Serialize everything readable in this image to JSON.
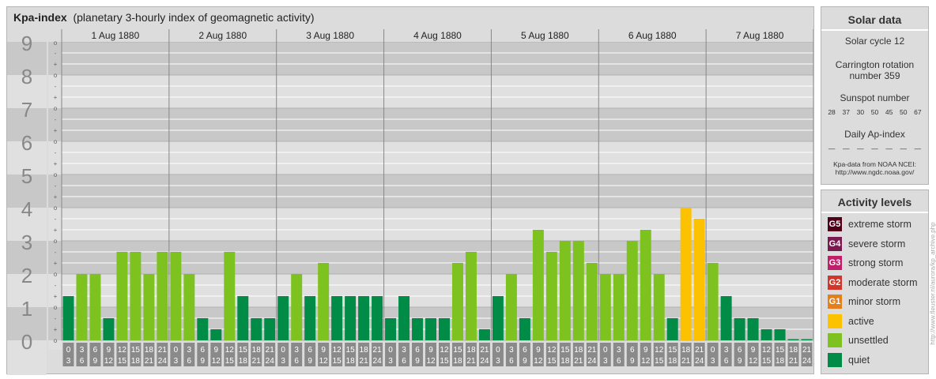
{
  "header": {
    "title": "Kpa-index",
    "subtitle": "(planetary 3-hourly index of geomagnetic activity)"
  },
  "chart_data": {
    "type": "bar",
    "title": "Kpa-index",
    "subtitle": "(planetary 3-hourly index of geomagnetic activity)",
    "ylim": [
      0,
      9
    ],
    "y_ticks": [
      "0",
      "1",
      "2",
      "3",
      "4",
      "5",
      "6",
      "7",
      "8",
      "9"
    ],
    "third_ticks": [
      "o",
      "+",
      "-"
    ],
    "days": [
      "1 Aug 1880",
      "2 Aug 1880",
      "3 Aug 1880",
      "4 Aug 1880",
      "5 Aug 1880",
      "6 Aug 1880",
      "7 Aug 1880"
    ],
    "interval_labels": [
      [
        "0",
        "3"
      ],
      [
        "3",
        "6"
      ],
      [
        "6",
        "9"
      ],
      [
        "9",
        "12"
      ],
      [
        "12",
        "15"
      ],
      [
        "15",
        "18"
      ],
      [
        "18",
        "21"
      ],
      [
        "21",
        "24"
      ]
    ],
    "values": [
      [
        1.333,
        2.0,
        2.0,
        0.667,
        2.667,
        2.667,
        2.0,
        2.667
      ],
      [
        2.667,
        2.0,
        0.667,
        0.333,
        2.667,
        1.333,
        0.667,
        0.667
      ],
      [
        1.333,
        2.0,
        1.333,
        2.333,
        1.333,
        1.333,
        1.333,
        1.333
      ],
      [
        0.667,
        1.333,
        0.667,
        0.667,
        0.667,
        2.333,
        2.667,
        0.333
      ],
      [
        1.333,
        2.0,
        0.667,
        3.333,
        2.667,
        3.0,
        3.0,
        2.333
      ],
      [
        2.0,
        2.0,
        3.0,
        3.333,
        2.0,
        0.667,
        4.0,
        3.667
      ],
      [
        2.333,
        1.333,
        0.667,
        0.667,
        0.333,
        0.333,
        0.0,
        0.0
      ]
    ],
    "levels": [
      "quiet",
      "unsettled",
      "active",
      "G1",
      "G2",
      "G3",
      "G4",
      "G5"
    ],
    "colors": {
      "quiet": "#008c46",
      "unsettled": "#7ec220",
      "active": "#fcc200",
      "G1": "#e4801c",
      "G2": "#d2352a",
      "G3": "#c11e6a",
      "G4": "#7a1a50",
      "G5": "#500018"
    }
  },
  "solar": {
    "title": "Solar data",
    "cycle": "Solar cycle 12",
    "carrington_line1": "Carrington rotation",
    "carrington_line2": "number 359",
    "sunspot_title": "Sunspot number",
    "sunspot_values": [
      "28",
      "37",
      "30",
      "50",
      "45",
      "50",
      "67"
    ],
    "ap_title": "Daily Ap-index",
    "ap_values": [
      "—",
      "—",
      "—",
      "—",
      "—",
      "—",
      "—"
    ],
    "credit_line1": "Kpa-data from NOAA NCEI:",
    "credit_line2": "http://www.ngdc.noaa.gov/"
  },
  "activity": {
    "title": "Activity levels",
    "items": [
      {
        "code": "G5",
        "label": "extreme storm",
        "color": "#500018"
      },
      {
        "code": "G4",
        "label": "severe storm",
        "color": "#7a1a50"
      },
      {
        "code": "G3",
        "label": "strong storm",
        "color": "#c11e6a"
      },
      {
        "code": "G2",
        "label": "moderate storm",
        "color": "#d2352a"
      },
      {
        "code": "G1",
        "label": "minor storm",
        "color": "#e4801c"
      },
      {
        "code": "",
        "label": "active",
        "color": "#fcc200"
      },
      {
        "code": "",
        "label": "unsettled",
        "color": "#7ec220"
      },
      {
        "code": "",
        "label": "quiet",
        "color": "#008c46"
      }
    ]
  },
  "side_credit": "http://www.fleuster.nl/aurora/kp_archive.php"
}
